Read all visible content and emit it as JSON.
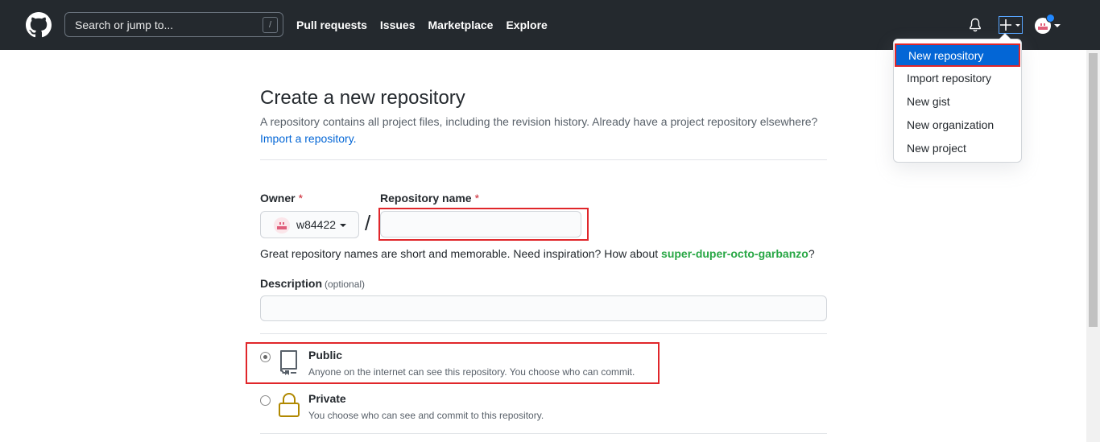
{
  "header": {
    "search_placeholder": "Search or jump to...",
    "search_shortcut": "/",
    "nav": [
      "Pull requests",
      "Issues",
      "Marketplace",
      "Explore"
    ]
  },
  "dropdown": {
    "items": [
      "New repository",
      "Import repository",
      "New gist",
      "New organization",
      "New project"
    ]
  },
  "main": {
    "title": "Create a new repository",
    "subtitle": "A repository contains all project files, including the revision history. Already have a project repository elsewhere?",
    "import_link": "Import a repository.",
    "owner_label": "Owner",
    "required_mark": "*",
    "owner_value": "w84422",
    "repo_label": "Repository name",
    "repo_value": "",
    "separator": "/",
    "hint_prefix": "Great repository names are short and memorable. Need inspiration? How about ",
    "hint_suggestion": "super-duper-octo-garbanzo",
    "hint_suffix": "?",
    "description_label": "Description",
    "description_optional": "(optional)",
    "description_value": "",
    "visibility": [
      {
        "title": "Public",
        "desc": "Anyone on the internet can see this repository. You choose who can commit.",
        "checked": true
      },
      {
        "title": "Private",
        "desc": "You choose who can see and commit to this repository.",
        "checked": false
      }
    ]
  },
  "colors": {
    "header_bg": "#24292e",
    "link": "#0366d6",
    "suggestion": "#28a745",
    "highlight": "#e0262a",
    "lock": "#b08800"
  }
}
